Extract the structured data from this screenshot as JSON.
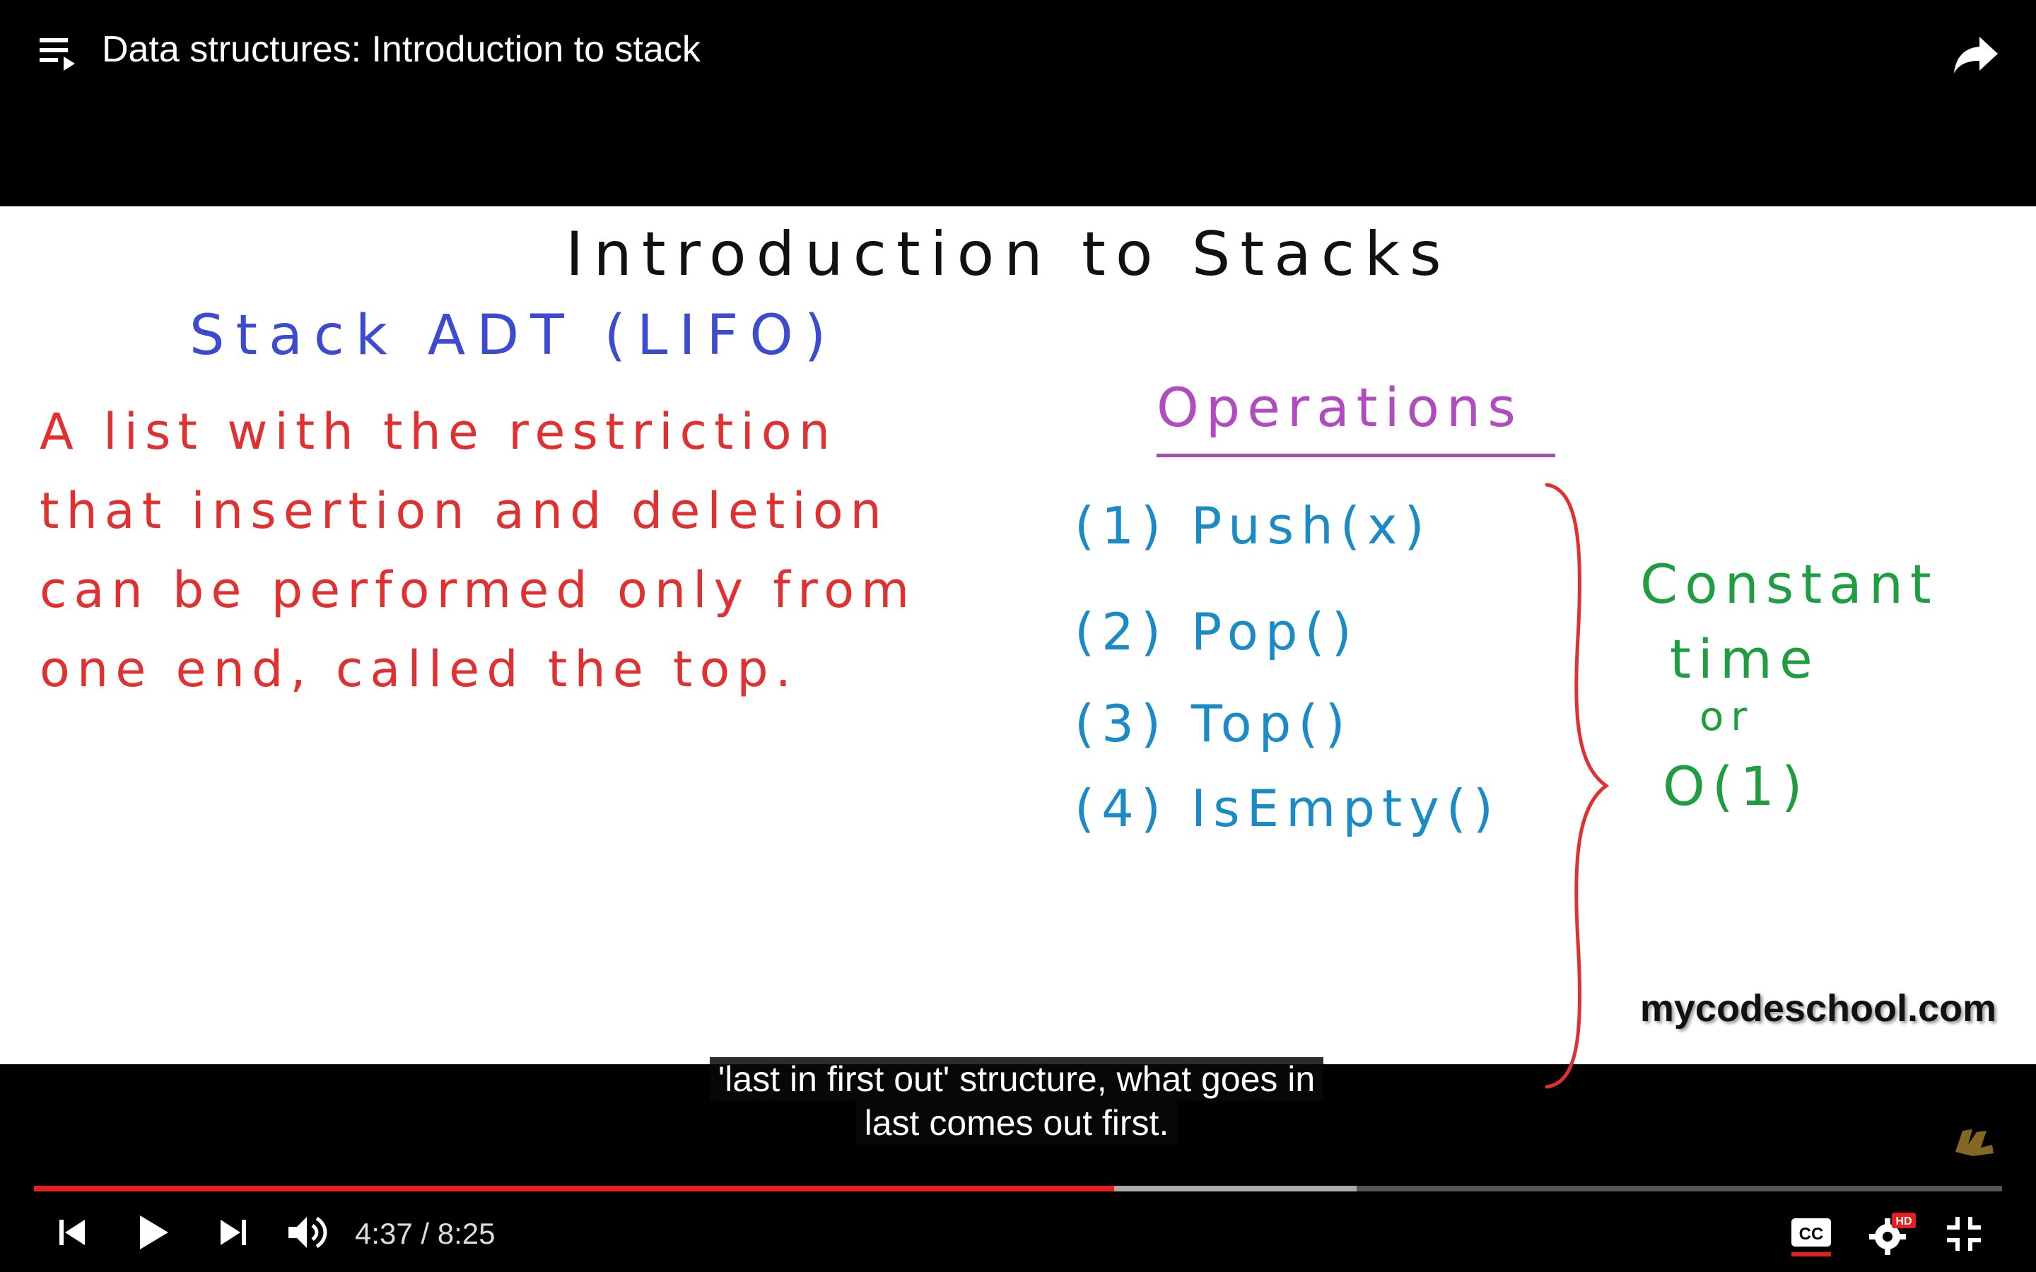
{
  "header": {
    "title": "Data structures: Introduction to stack",
    "playlist_icon": "playlist-icon",
    "share_icon": "share-icon"
  },
  "slide": {
    "title": "Introduction to Stacks",
    "adt_label": "Stack ADT (LIFO)",
    "definition_lines": [
      "A list with the restriction",
      "that insertion and deletion",
      "can be performed only from",
      "one end, called the top."
    ],
    "operations_heading": "Operations",
    "operations": [
      "(1) Push(x)",
      "(2) Pop()",
      "(3) Top()",
      "(4) IsEmpty()"
    ],
    "complexity_lines": [
      "Constant",
      "time",
      "or",
      "O(1)"
    ],
    "watermark": "mycodeschool.com",
    "colors": {
      "title": "#111111",
      "adt": "#3d4bd0",
      "definition": "#e03030",
      "operations_heading": "#b04bc0",
      "operations": "#1a8bc6",
      "brace": "#e03030",
      "complexity": "#1e9e40"
    }
  },
  "caption": {
    "line1": "'last in first out' structure, what goes in",
    "line2": "last comes out first."
  },
  "player": {
    "current_time": "4:37",
    "duration": "8:25",
    "time_display": "4:37 / 8:25",
    "played_fraction": 0.549,
    "buffered_fraction": 0.672,
    "accent_color": "#e61e1e",
    "icons": [
      "skip-previous-icon",
      "play-icon",
      "skip-next-icon",
      "volume-icon",
      "captions-icon",
      "settings-icon",
      "exit-fullscreen-icon"
    ],
    "settings_badge": "HD",
    "cc_label": "CC"
  }
}
